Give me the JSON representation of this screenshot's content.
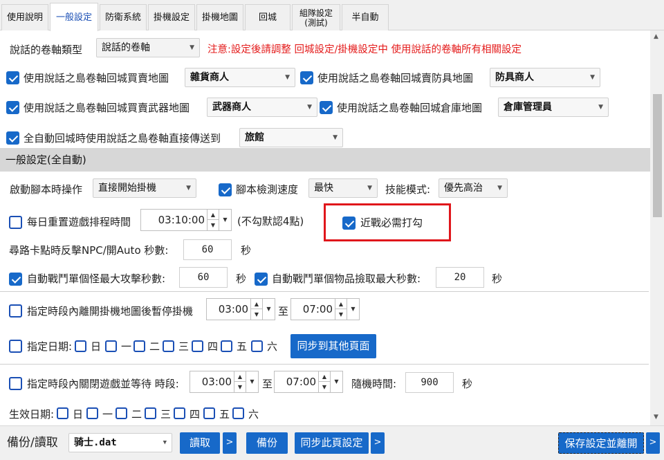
{
  "tabs": [
    {
      "label": "使用說明"
    },
    {
      "label": "一般設定"
    },
    {
      "label": "防衛系統"
    },
    {
      "label": "掛機設定"
    },
    {
      "label": "掛機地圖"
    },
    {
      "label": "回城"
    },
    {
      "label": "組隊設定\n(測試)"
    },
    {
      "label": "半自動"
    }
  ],
  "scroll_type": {
    "label": "說話的卷軸類型",
    "value": "說話的卷軸",
    "note": "注意:設定後請調整 回城設定/掛機設定中 使用說話的卷軸所有相關設定"
  },
  "return_town": {
    "grocery": {
      "label": "使用說話之島卷軸回城買賣地圖",
      "value": "雜貨商人",
      "checked": true
    },
    "armor": {
      "label": "使用說話之島卷軸回城賣防具地圖",
      "value": "防具商人",
      "checked": true
    },
    "weapon": {
      "label": "使用說話之島卷軸回城買賣武器地圖",
      "value": "武器商人",
      "checked": true
    },
    "warehouse": {
      "label": "使用說話之島卷軸回城倉庫地圖",
      "value": "倉庫管理員",
      "checked": true
    },
    "teleport": {
      "label": "全自動回城時使用說話之島卷軸直接傳送到",
      "value": "旅館",
      "checked": true
    }
  },
  "section_title": "一般設定(全自動)",
  "general": {
    "start_action_label": "啟動腳本時操作",
    "start_action_value": "直接開始掛機",
    "detect_speed_label": "腳本檢測速度",
    "detect_speed_value": "最快",
    "skill_mode_label": "技能模式:",
    "skill_mode_value": "優先高治",
    "daily_reset_label": "每日重置遊戲排程時間",
    "daily_reset_time": "03:10:00",
    "daily_reset_note": "(不勾默認4點)",
    "melee_label": "近戰必需打勾",
    "path_stuck_label": "尋路卡點時反擊NPC/開Auto 秒數:",
    "path_stuck_value": "60",
    "seconds": "秒",
    "max_attack_label": "自動戰鬥單個怪最大攻擊秒數:",
    "max_attack_value": "60",
    "max_pickup_label": "自動戰鬥單個物品撿取最大秒數:",
    "max_pickup_value": "20"
  },
  "pause_period": {
    "label": "指定時段內離開掛機地圖後暫停掛機",
    "from": "03:00",
    "to_label": "至",
    "to": "07:00",
    "date_label": "指定日期:",
    "days": [
      "日",
      "一",
      "二",
      "三",
      "四",
      "五",
      "六"
    ],
    "sync_button": "同步到其他頁面"
  },
  "close_period": {
    "label": "指定時段內關閉遊戲並等待 時段:",
    "from": "03:00",
    "to_label": "至",
    "to": "07:00",
    "random_label": "隨機時間:",
    "random_value": "900",
    "seconds": "秒",
    "date_label": "生效日期:",
    "days": [
      "日",
      "一",
      "二",
      "三",
      "四",
      "五",
      "六"
    ]
  },
  "bottom": {
    "backup_label": "備份/讀取",
    "file_value": "骑士.dat",
    "read_button": "讀取",
    "more": ">",
    "backup_button": "備份",
    "sync_page_button": "同步此頁設定",
    "save_button": "保存設定並離開"
  },
  "colors": {
    "accent": "#1769c9",
    "highlight": "#e0161b",
    "note": "#e41b1b"
  }
}
